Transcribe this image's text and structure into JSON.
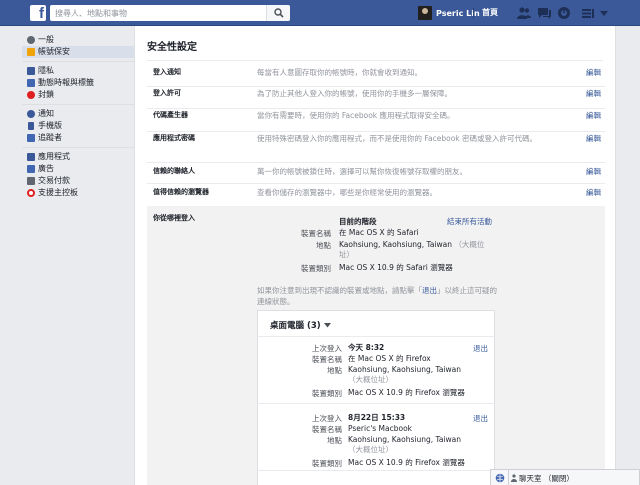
{
  "search": {
    "placeholder": "搜尋人、地點和事物"
  },
  "header": {
    "user_name": "Pseric Lin",
    "home_label": "首頁",
    "icons": [
      "friend-requests-icon",
      "messages-icon",
      "notifications-icon",
      "privacy-shortcuts-icon",
      "account-menu-icon"
    ]
  },
  "sidebar": {
    "groups": [
      {
        "items": [
          {
            "label": "一般",
            "icon": "gear-icon",
            "color": "#606770"
          },
          {
            "label": "帳號保安",
            "icon": "lock-icon",
            "color": "#f0a30a",
            "selected": true
          }
        ]
      },
      {
        "items": [
          {
            "label": "隱私",
            "icon": "padlock-icon",
            "color": "#3b5998"
          },
          {
            "label": "動態時報與標籤",
            "icon": "timeline-icon",
            "color": "#3b5998"
          },
          {
            "label": "封鎖",
            "icon": "block-icon",
            "color": "#e02020"
          }
        ]
      },
      {
        "items": [
          {
            "label": "通知",
            "icon": "globe-icon",
            "color": "#3b5998"
          },
          {
            "label": "手機版",
            "icon": "mobile-icon",
            "color": "#3b5998"
          },
          {
            "label": "追蹤者",
            "icon": "rss-icon",
            "color": "#3b5998"
          }
        ]
      },
      {
        "items": [
          {
            "label": "應用程式",
            "icon": "apps-icon",
            "color": "#3b5998"
          },
          {
            "label": "廣告",
            "icon": "ads-icon",
            "color": "#3b5998"
          },
          {
            "label": "交易付款",
            "icon": "payments-icon",
            "color": "#3b5998"
          },
          {
            "label": "支援主控板",
            "icon": "lifebuoy-icon",
            "color": "#e02020"
          }
        ]
      }
    ]
  },
  "main": {
    "title": "安全性設定",
    "edit_label": "編輯",
    "rows": [
      {
        "label": "登入通知",
        "desc": "每當有人意圖存取你的帳號時，你就會收到通知。"
      },
      {
        "label": "登入許可",
        "desc": "為了防止其他人登入你的帳號，使用你的手機多一層保障。"
      },
      {
        "label": "代碼產生器",
        "desc": "當你有需要時，使用你的 Facebook 應用程式取得安全碼。"
      },
      {
        "label": "應用程式密碼",
        "desc": "使用特殊密碼登入你的應用程式，而不是使用你的 Facebook 密碼或登入許可代碼。"
      },
      {
        "label": "信賴的聯絡人",
        "desc": "萬一你的帳號被鎖住時，選擇可以幫你恢復帳號存取權的朋友。"
      },
      {
        "label": "值得信賴的瀏覽器",
        "desc": "查看你儲存的瀏覽器中，哪些是你經常使用的瀏覽器。"
      }
    ],
    "where": {
      "label": "你從哪裡登入",
      "current_title": "目前的階段",
      "end_all": "結束所有活動",
      "current": {
        "device_name_key": "裝置名稱",
        "device_name": "在 Mac OS X 的 Safari",
        "location_key": "地點",
        "location": "Kaohsiung, Kaohsiung, Taiwan",
        "location_approx": "（大概位址）",
        "device_type_key": "裝置類別",
        "device_type": "Mac OS X 10.9 的 Safari 瀏覽器"
      },
      "notice_text": "如果你注意到出現不認識的裝置或地點，請點擊「",
      "notice_link": "退出",
      "notice_tail": "」以終止這可疑的連線狀態。",
      "desktop": {
        "title": "桌面電腦 (3)",
        "logout_label": "退出",
        "last_login_key": "上次登入",
        "device_name_key": "裝置名稱",
        "location_key": "地點",
        "device_type_key": "裝置類別",
        "approx": "（大概位址）",
        "sessions": [
          {
            "last_login": "今天 8:32",
            "device_name": "在 Mac OS X 的 Firefox",
            "location": "Kaohsiung, Kaohsiung, Taiwan",
            "device_type": "Mac OS X 10.9 的 Firefox 瀏覽器"
          },
          {
            "last_login": "8月22日 15:33",
            "device_name": "Pseric's Macbook",
            "location": "Kaohsiung, Kaohsiung, Taiwan",
            "device_type": "Mac OS X 10.9 的 Firefox 瀏覽器"
          }
        ]
      }
    }
  },
  "chat": {
    "label": "聊天室 （關閉）"
  },
  "colors": {
    "brand": "#3b5998",
    "link": "#365899",
    "muted": "#90949c"
  }
}
